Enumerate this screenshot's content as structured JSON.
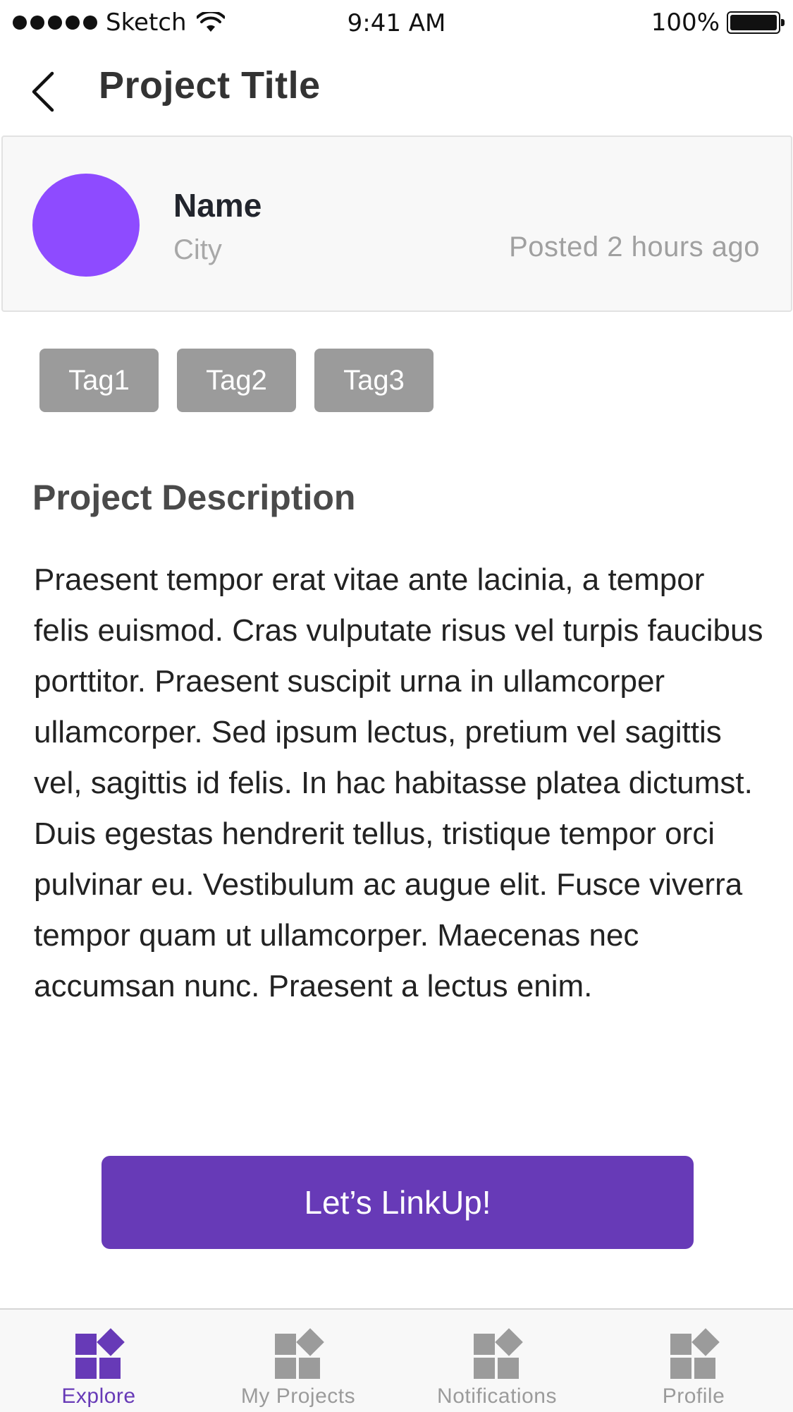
{
  "status_bar": {
    "carrier": "Sketch",
    "time": "9:41 AM",
    "battery": "100%"
  },
  "header": {
    "title": "Project Title"
  },
  "author": {
    "name": "Name",
    "city": "City",
    "posted": "Posted 2 hours ago",
    "avatar_color": "#8e4bff"
  },
  "tags": [
    "Tag1",
    "Tag2",
    "Tag3"
  ],
  "description": {
    "heading": "Project Description",
    "body": "Praesent tempor erat vitae ante lacinia, a tempor felis euismod. Cras vulputate risus vel turpis faucibus porttitor. Praesent suscipit urna in ullamcorper ullamcorper. Sed ipsum lectus, pretium vel sagittis vel, sagittis id felis. In hac habitasse platea dictumst. Duis egestas hendrerit tellus, tristique tempor orci pulvinar eu. Vestibulum ac augue elit. Fusce viverra tempor quam ut ullamcorper. Maecenas nec accumsan nunc. Praesent a lectus enim."
  },
  "cta": {
    "label": "Let’s LinkUp!",
    "color": "#673ab7"
  },
  "tab_bar": {
    "active_color": "#673ab7",
    "inactive_color": "#9b9b9b",
    "items": [
      {
        "label": "Explore",
        "icon": "grid-icon",
        "active": true
      },
      {
        "label": "My Projects",
        "icon": "grid-icon",
        "active": false
      },
      {
        "label": "Notifications",
        "icon": "grid-icon",
        "active": false
      },
      {
        "label": "Profile",
        "icon": "grid-icon",
        "active": false
      }
    ]
  }
}
